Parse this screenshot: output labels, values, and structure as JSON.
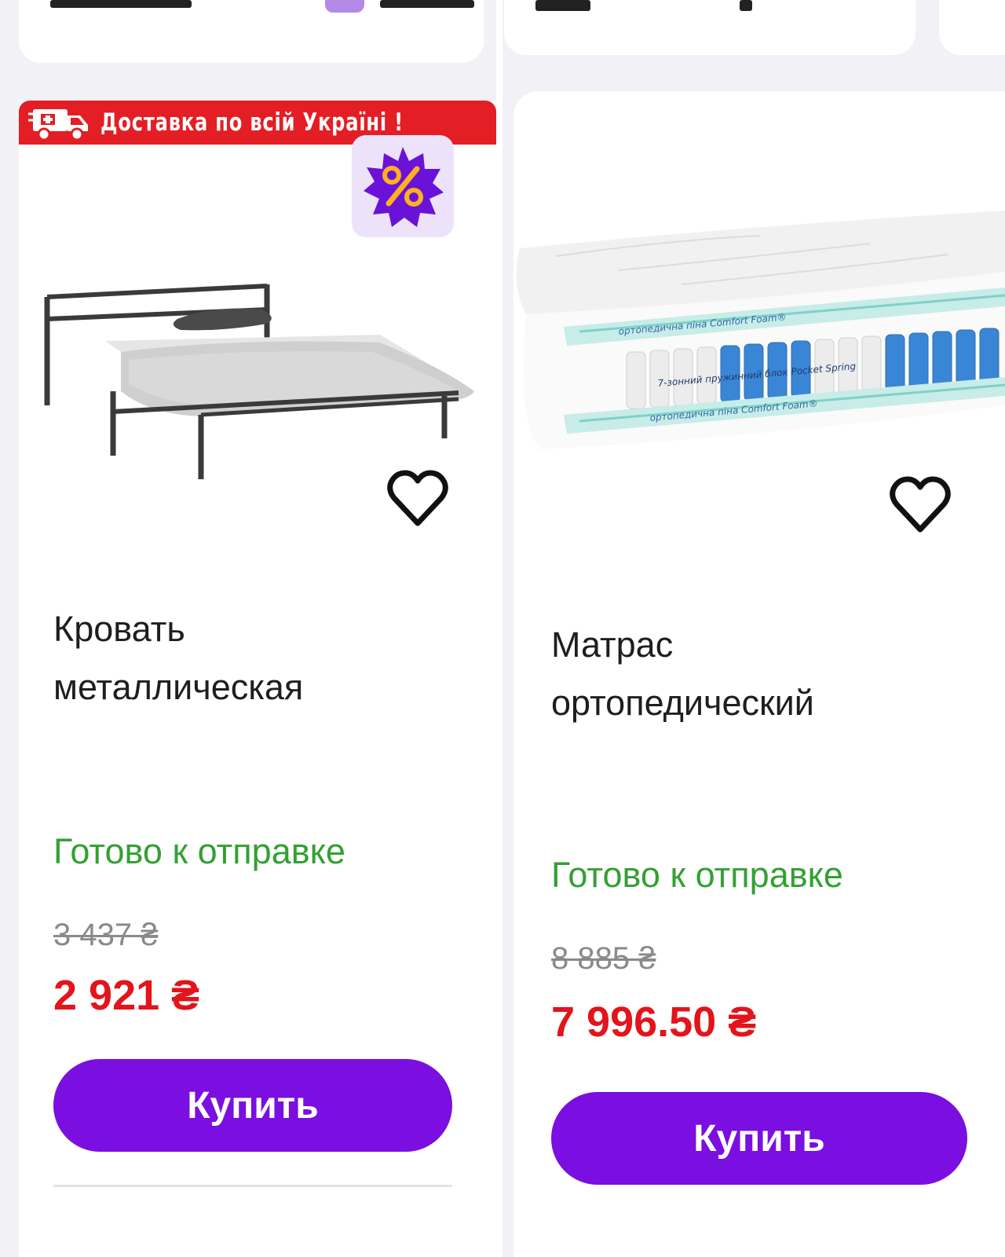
{
  "delivery_banner": {
    "text": "Доставка по всій Україні !"
  },
  "icons": {
    "truck": "delivery-truck-icon",
    "promo": "percent-badge-icon",
    "favorite": "heart-icon"
  },
  "colors": {
    "accent": "#7b0ee0",
    "price_red": "#e3141b",
    "status_green": "#34a033",
    "banner_red": "#e31e24",
    "badge_bg": "#ece3fb",
    "badge_star": "#6a12d8",
    "badge_percent": "#ffb01f"
  },
  "products": [
    {
      "title_line1": "Кровать",
      "title_line2": "металлическая",
      "status": "Готово к отправке",
      "old_price": "3 437 ₴",
      "price": "2 921 ₴",
      "buy_label": "Купить"
    },
    {
      "title_line1": "Матрас",
      "title_line2": "ортопедический",
      "status": "Готово к отправке",
      "old_price": "8 885 ₴",
      "price": "7 996.50 ₴",
      "buy_label": "Купить",
      "image_labels": {
        "foam_top": "ортопедична піна Comfort Foam®",
        "spring_block": "7-зонний пружинний блок Pocket Spring",
        "foam_bottom": "ортопедична піна Comfort Foam®"
      }
    }
  ]
}
